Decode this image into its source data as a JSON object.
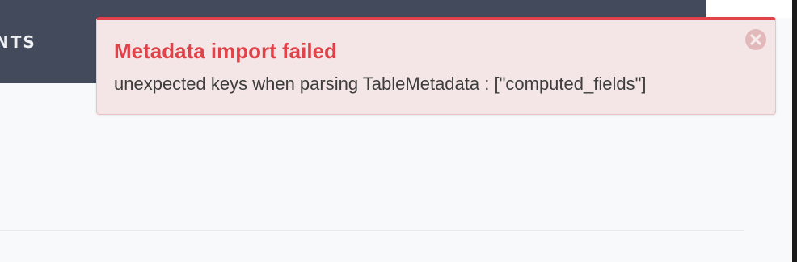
{
  "navbar": {
    "partial_tab_label": "NTS"
  },
  "notification": {
    "title": "Metadata import failed",
    "message": "unexpected keys when parsing TableMetadata : [\"computed_fields\"]",
    "close_icon": "close-circle-icon",
    "accent_color": "#e0424a",
    "background_color": "#f4e6e6"
  },
  "colors": {
    "navbar": "#424a5b",
    "page_background": "#f8f9fb"
  }
}
